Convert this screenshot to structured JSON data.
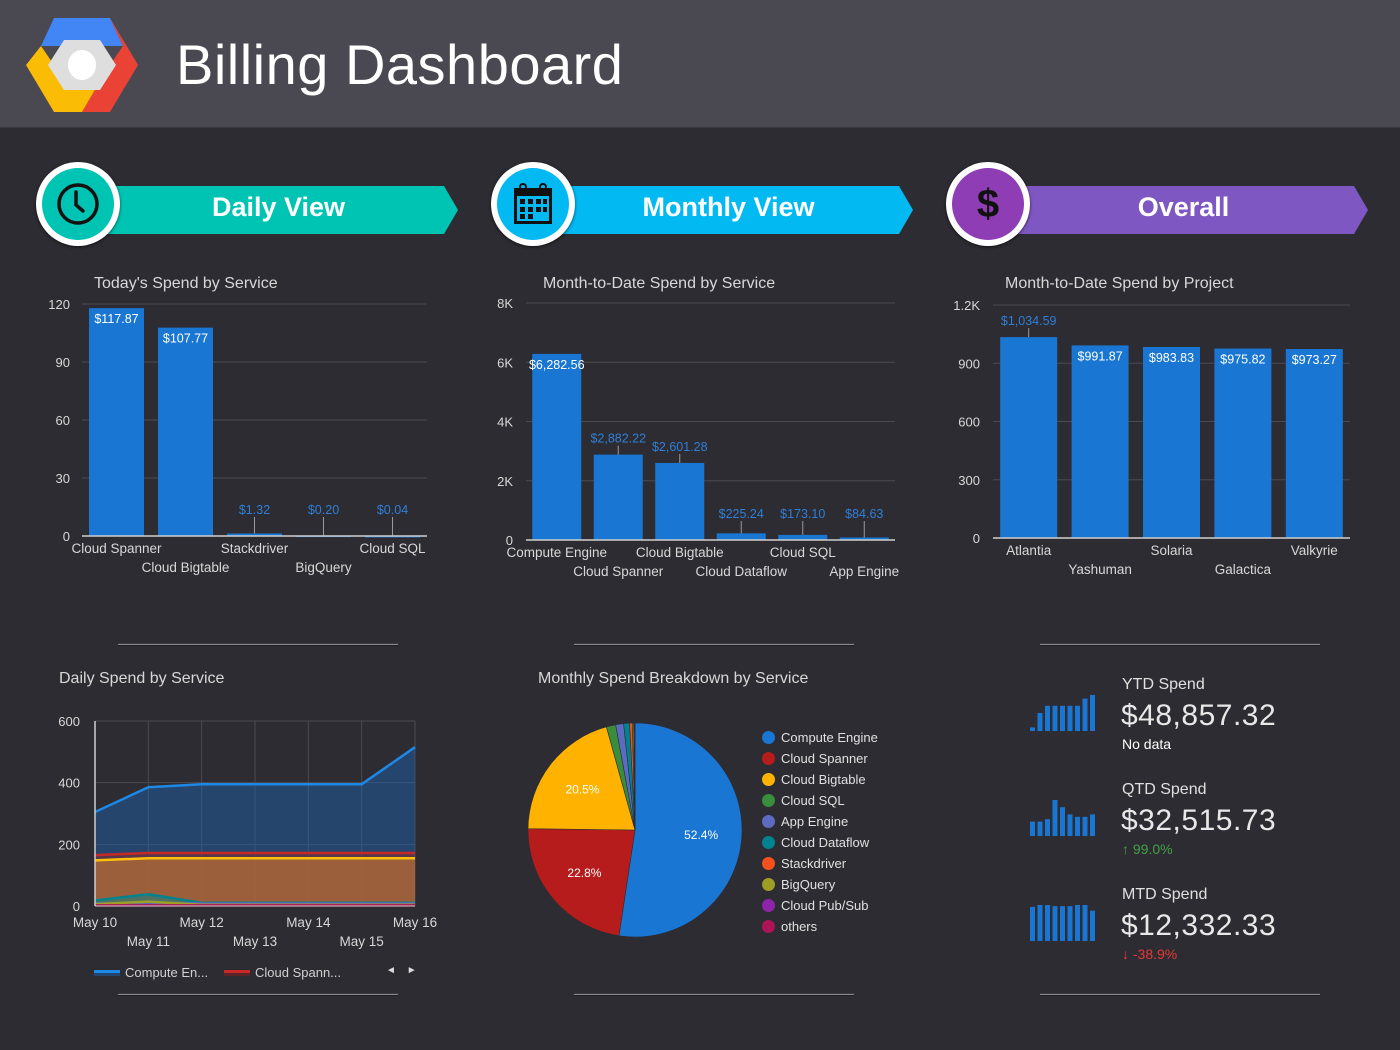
{
  "header": {
    "title": "Billing Dashboard",
    "logo": "google-cloud-hexagon-logo"
  },
  "colors": {
    "background": "#2d2c32",
    "header": "#4a4952",
    "bar": "#1976d2",
    "daily_banner": "#00c4b3",
    "monthly_banner": "#03b9f2",
    "overall_banner": "#7e57c2",
    "positive": "#43a047",
    "negative": "#e53935"
  },
  "banners": [
    {
      "label": "Daily View",
      "icon": "clock-icon",
      "color": "#00c4b3"
    },
    {
      "label": "Monthly View",
      "icon": "calendar-icon",
      "color": "#03b9f2"
    },
    {
      "label": "Overall",
      "icon": "dollar-icon",
      "color": "#7e57c2"
    }
  ],
  "chart_data": [
    {
      "type": "bar",
      "title": "Today's Spend by Service",
      "categories": [
        "Cloud Spanner",
        "Cloud Bigtable",
        "Stackdriver",
        "BigQuery",
        "Cloud SQL"
      ],
      "values": [
        117.87,
        107.77,
        1.32,
        0.2,
        0.04
      ],
      "labels": [
        "$117.87",
        "$107.77",
        "$1.32",
        "$0.20",
        "$0.04"
      ],
      "yticks": [
        "0",
        "30",
        "60",
        "90",
        "120"
      ],
      "ylim": [
        0,
        120
      ],
      "xlabel": "",
      "ylabel": "",
      "grid": true
    },
    {
      "type": "bar",
      "title": "Month-to-Date Spend by Service",
      "categories": [
        "Compute Engine",
        "Cloud Spanner",
        "Cloud Bigtable",
        "Cloud Dataflow",
        "Cloud SQL",
        "App Engine"
      ],
      "values": [
        6282.56,
        2882.22,
        2601.28,
        225.24,
        173.1,
        84.63
      ],
      "labels": [
        "$6,282.56",
        "$2,882.22",
        "$2,601.28",
        "$225.24",
        "$173.10",
        "$84.63"
      ],
      "yticks": [
        "0",
        "2K",
        "4K",
        "6K",
        "8K"
      ],
      "ylim": [
        0,
        8000
      ],
      "xlabel": "",
      "ylabel": "",
      "grid": true
    },
    {
      "type": "bar",
      "title": "Month-to-Date Spend by Project",
      "categories": [
        "Atlantia",
        "Yashuman",
        "Solaria",
        "Galactica",
        "Valkyrie"
      ],
      "values": [
        1034.59,
        991.87,
        983.83,
        975.82,
        973.27
      ],
      "labels": [
        "$1,034.59",
        "$991.87",
        "$983.83",
        "$975.82",
        "$973.27"
      ],
      "yticks": [
        "0",
        "300",
        "600",
        "900",
        "1.2K"
      ],
      "ylim": [
        0,
        1200
      ],
      "xlabel": "",
      "ylabel": "",
      "grid": true
    },
    {
      "type": "area",
      "title": "Daily Spend by Service",
      "x": [
        "May 10",
        "May 11",
        "May 12",
        "May 13",
        "May 14",
        "May 15",
        "May 16"
      ],
      "yticks": [
        "0",
        "200",
        "400",
        "600"
      ],
      "ylim": [
        0,
        600
      ],
      "series": [
        {
          "name": "Compute Engine",
          "short": "Compute En...",
          "color": "#1e88e5",
          "values": [
            305,
            385,
            395,
            395,
            395,
            395,
            515
          ]
        },
        {
          "name": "Cloud Spanner",
          "short": "Cloud Spann...",
          "color": "#c62828",
          "values": [
            165,
            172,
            172,
            172,
            172,
            172,
            172
          ]
        },
        {
          "name": "Cloud Bigtable",
          "color": "#ffc107",
          "values": [
            148,
            155,
            155,
            155,
            155,
            155,
            155
          ]
        },
        {
          "name": "Cloud Dataflow",
          "color": "#00838f",
          "values": [
            18,
            38,
            10,
            10,
            10,
            10,
            10
          ]
        },
        {
          "name": "App Engine",
          "color": "#5c6bc0",
          "values": [
            8,
            10,
            8,
            8,
            8,
            8,
            8
          ]
        },
        {
          "name": "BigQuery",
          "color": "#9e9d24",
          "values": [
            6,
            14,
            4,
            4,
            4,
            4,
            4
          ]
        },
        {
          "name": "others",
          "color": "#ad1457",
          "values": [
            2,
            2,
            2,
            2,
            2,
            2,
            2
          ]
        }
      ],
      "legend": "bottom",
      "grid": true
    },
    {
      "type": "pie",
      "title": "Monthly Spend Breakdown by Service",
      "slices": [
        {
          "name": "Compute Engine",
          "value": 52.4,
          "label": "52.4%",
          "color": "#1976d2"
        },
        {
          "name": "Cloud Spanner",
          "value": 22.8,
          "label": "22.8%",
          "color": "#b71c1c"
        },
        {
          "name": "Cloud Bigtable",
          "value": 20.5,
          "label": "20.5%",
          "color": "#ffb300"
        },
        {
          "name": "Cloud SQL",
          "value": 1.4,
          "label": "",
          "color": "#388e3c"
        },
        {
          "name": "App Engine",
          "value": 1.2,
          "label": "",
          "color": "#5c6bc0"
        },
        {
          "name": "Cloud Dataflow",
          "value": 0.9,
          "label": "",
          "color": "#00838f"
        },
        {
          "name": "Stackdriver",
          "value": 0.4,
          "label": "",
          "color": "#f4511e"
        },
        {
          "name": "BigQuery",
          "value": 0.2,
          "label": "",
          "color": "#9e9d24"
        },
        {
          "name": "Cloud Pub/Sub",
          "value": 0.1,
          "label": "",
          "color": "#8e24aa"
        },
        {
          "name": "others",
          "value": 0.1,
          "label": "",
          "color": "#ad1457"
        }
      ],
      "legend": "right"
    }
  ],
  "kpis": [
    {
      "label": "YTD Spend",
      "value": "$48,857.32",
      "sub": "No data",
      "trend": "none",
      "spark": [
        1,
        5,
        7,
        7,
        7,
        7,
        7,
        9,
        10
      ]
    },
    {
      "label": "QTD Spend",
      "value": "$32,515.73",
      "sub": "99.0%",
      "trend": "up",
      "spark": [
        3,
        3,
        3.5,
        7.5,
        6,
        4.5,
        4,
        4,
        4.5
      ]
    },
    {
      "label": "MTD Spend",
      "value": "$12,332.33",
      "sub": "-38.9%",
      "trend": "down",
      "spark": [
        9,
        9.5,
        9.5,
        9.2,
        9.2,
        9.2,
        9.5,
        9.5,
        8
      ]
    }
  ],
  "legend_pager": {
    "prev": "◄",
    "next": "►"
  }
}
